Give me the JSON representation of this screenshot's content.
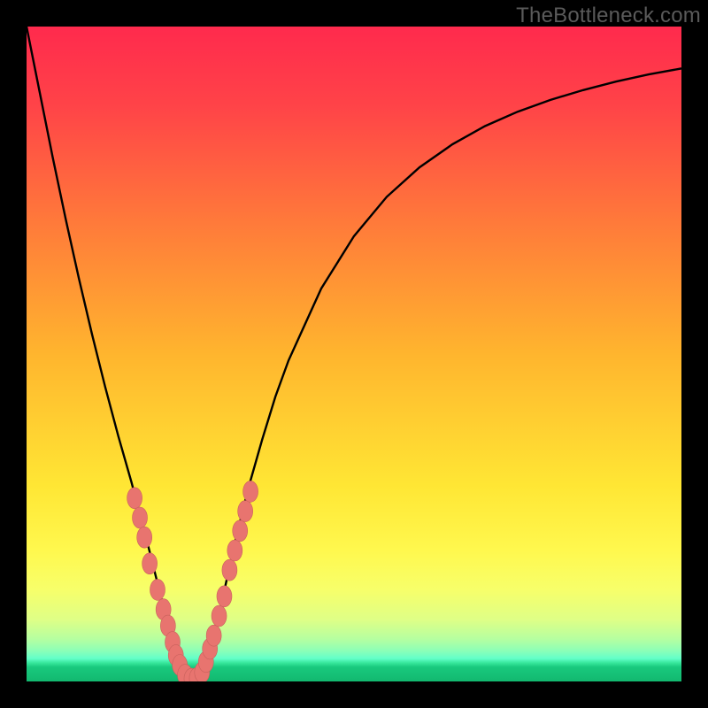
{
  "watermark": "TheBottleneck.com",
  "colors": {
    "frame": "#000000",
    "curve_stroke": "#000000",
    "marker_fill": "#e8746f",
    "marker_stroke": "#c9615c",
    "gradient_stops": [
      {
        "offset": 0.0,
        "color": "#ff2a4d"
      },
      {
        "offset": 0.12,
        "color": "#ff4348"
      },
      {
        "offset": 0.3,
        "color": "#ff7a3a"
      },
      {
        "offset": 0.5,
        "color": "#ffb52e"
      },
      {
        "offset": 0.7,
        "color": "#ffe634"
      },
      {
        "offset": 0.8,
        "color": "#fff84e"
      },
      {
        "offset": 0.86,
        "color": "#f7ff6a"
      },
      {
        "offset": 0.905,
        "color": "#dfff86"
      },
      {
        "offset": 0.935,
        "color": "#b6ffa0"
      },
      {
        "offset": 0.953,
        "color": "#8cffb7"
      },
      {
        "offset": 0.965,
        "color": "#63ffc9"
      },
      {
        "offset": 0.972,
        "color": "#35e59a"
      },
      {
        "offset": 0.978,
        "color": "#19c97e"
      },
      {
        "offset": 1.0,
        "color": "#12b86f"
      }
    ]
  },
  "chart_data": {
    "type": "line",
    "title": "",
    "xlabel": "",
    "ylabel": "",
    "xlim": [
      0,
      100
    ],
    "ylim": [
      0,
      100
    ],
    "x": [
      0,
      2,
      4,
      6,
      8,
      10,
      12,
      14,
      16,
      18,
      19,
      20,
      21,
      22,
      23,
      24,
      25,
      26,
      27,
      28,
      29,
      30,
      32,
      34,
      36,
      38,
      40,
      45,
      50,
      55,
      60,
      65,
      70,
      75,
      80,
      85,
      90,
      95,
      100
    ],
    "values": [
      100,
      90,
      80,
      70.5,
      61.5,
      53,
      45,
      37.5,
      30.5,
      23,
      19,
      15,
      11,
      7,
      3.5,
      1.5,
      0.5,
      0.6,
      1.8,
      4.5,
      8.5,
      13,
      22,
      30,
      37,
      43.5,
      49,
      60,
      68,
      74,
      78.5,
      82,
      84.8,
      87,
      88.8,
      90.3,
      91.6,
      92.7,
      93.6
    ],
    "markers": [
      {
        "x": 16.5,
        "y": 28
      },
      {
        "x": 17.3,
        "y": 25
      },
      {
        "x": 18.0,
        "y": 22
      },
      {
        "x": 18.8,
        "y": 18
      },
      {
        "x": 20.0,
        "y": 14
      },
      {
        "x": 20.9,
        "y": 11
      },
      {
        "x": 21.6,
        "y": 8.5
      },
      {
        "x": 22.3,
        "y": 6
      },
      {
        "x": 22.8,
        "y": 4
      },
      {
        "x": 23.4,
        "y": 2.5
      },
      {
        "x": 24.2,
        "y": 1
      },
      {
        "x": 25.2,
        "y": 0.4
      },
      {
        "x": 26.0,
        "y": 0.5
      },
      {
        "x": 26.8,
        "y": 1.4
      },
      {
        "x": 27.4,
        "y": 3
      },
      {
        "x": 28.0,
        "y": 5
      },
      {
        "x": 28.6,
        "y": 7
      },
      {
        "x": 29.4,
        "y": 10
      },
      {
        "x": 30.2,
        "y": 13
      },
      {
        "x": 31.0,
        "y": 17
      },
      {
        "x": 31.8,
        "y": 20
      },
      {
        "x": 32.6,
        "y": 23
      },
      {
        "x": 33.4,
        "y": 26
      },
      {
        "x": 34.2,
        "y": 29
      }
    ]
  }
}
